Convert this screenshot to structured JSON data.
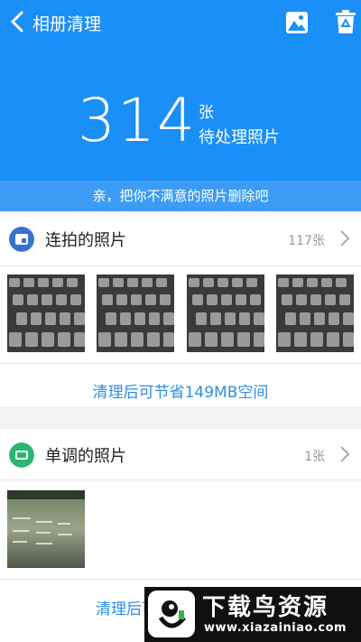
{
  "header": {
    "title": "相册清理",
    "count": "314",
    "unit": "张",
    "pending_label": "待处理照片",
    "tip": "亲，把你不满意的照片删除吧"
  },
  "sections": [
    {
      "title": "连拍的照片",
      "count": "117张",
      "save_text": "清理后可节省149MB空间",
      "icon": "burst-photo-icon",
      "icon_color": "#3b6fd8"
    },
    {
      "title": "单调的照片",
      "count": "1张",
      "save_text": "清理后可",
      "icon": "monotone-photo-icon",
      "icon_color": "#2bb673"
    }
  ],
  "watermark": {
    "brand": "下载鸟资源",
    "url": "www.xiazainiao.com"
  },
  "colors": {
    "header_bg": "#1a8ff8",
    "tip_bg": "#3c9cf5",
    "accent_text": "#2b8fe8"
  }
}
